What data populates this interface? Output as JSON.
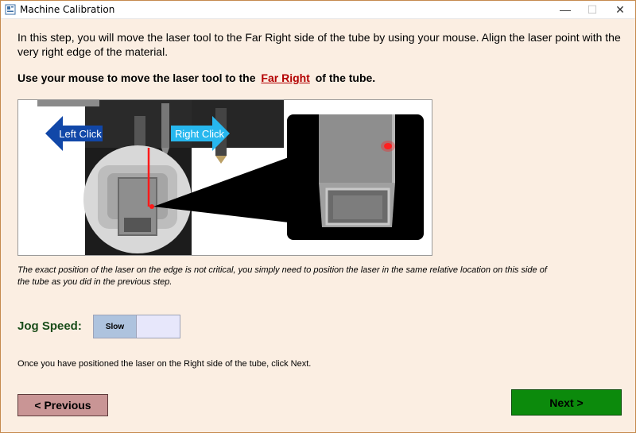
{
  "window": {
    "title": "Machine Calibration",
    "min_glyph": "—",
    "max_glyph": "☐",
    "close_glyph": "✕"
  },
  "intro_text": "In this step, you will move the laser tool to the Far Right side of the tube by using your mouse. Align the laser point with the very right edge of the material.",
  "instruction": {
    "prefix": "Use your mouse to move the laser tool to the",
    "link": "Far Right",
    "suffix": "of the tube."
  },
  "figure": {
    "left_arrow_label": "Left Click",
    "right_arrow_label": "Right Click",
    "colors": {
      "left_arrow": "#1147a8",
      "right_arrow": "#27b7ee",
      "laser": "#ff1a1a"
    }
  },
  "note_text": "The exact position of the laser on the edge is not critical, you simply need to position the laser in the same relative location on this side of the tube as you did in the previous step.",
  "jog": {
    "label": "Jog Speed:",
    "selected": "Slow"
  },
  "footer_text": "Once you have positioned the laser on the Right side of the tube, click Next.",
  "buttons": {
    "previous": "< Previous",
    "next": "Next >"
  },
  "colors": {
    "background": "#fbeee2",
    "previous_button": "#c99595",
    "next_button": "#0c8a0c",
    "link": "#b30000"
  }
}
